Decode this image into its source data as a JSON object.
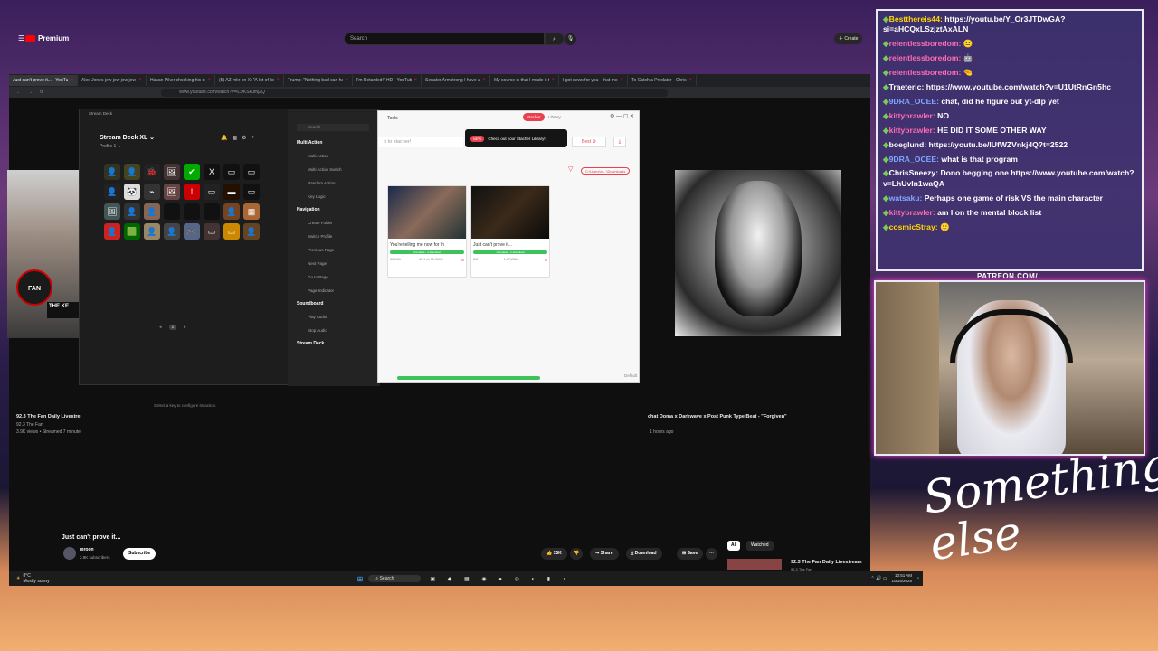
{
  "browser": {
    "tabs": [
      "Just can't prove it... - YouTube",
      "Alex Jones jew jew jew jew",
      "Hasan Piker shocking his dog o",
      "(5) AZ mkr on X: \"A lot of boss",
      "Trump: \"Nothing bad can happ",
      "I'm Retarded!\" HD - YouTube",
      "Senator Armstrong I have a dre",
      "My source is that I made it the",
      "I got news for you - that mean",
      "To Catch a Predator - Chris Ha"
    ],
    "url": "www.youtube.com/watch?v=iC9KSkumj2Q"
  },
  "youtube": {
    "logo": "Premium",
    "search_placeholder": "Search",
    "create_label": "Create",
    "left_video": {
      "badge": "FAN",
      "caption": "THE KE",
      "title": "92.3 The Fan Daily Livestre",
      "channel": "92.3 The Fan",
      "meta": "3.9K views • Streamed 7 minute"
    },
    "right_video": {
      "title": "chat Doma x Darkwave x Post Punk Type Beat - \"Forgiven\"",
      "meta": "1 hours ago"
    },
    "main": {
      "title": "Just can't prove it...",
      "channel": "mroon",
      "subs": "2.8K subscribers",
      "subscribe": "Subscribe",
      "likes": "15K",
      "share": "Share",
      "download": "Download",
      "save": "Save"
    },
    "chips": [
      "All",
      "Watched"
    ],
    "sidebar_next": {
      "title": "92.3 The Fan Daily Livestream",
      "channel": "92.3 The Fan"
    }
  },
  "streamdeck": {
    "window_title": "Stream Deck",
    "device": "Stream Deck XL",
    "profile": "Profile 1",
    "pager": "1",
    "hint": "Select a key to configure its action.",
    "search_placeholder": "Search",
    "categories": [
      {
        "name": "Multi Action",
        "items": [
          "Multi Action",
          "Multi Action Switch",
          "Random Action",
          "Key Logic"
        ]
      },
      {
        "name": "Navigation",
        "items": [
          "Create Folder",
          "Switch Profile",
          "Previous Page",
          "Next Page",
          "Go to Page",
          "Page Indicator"
        ]
      },
      {
        "name": "Soundboard",
        "items": [
          "Play Audio",
          "Stop Audio"
        ]
      },
      {
        "name": "Stream Deck",
        "items": []
      }
    ],
    "keys": [
      "👤",
      "👤",
      "🐞",
      "🖼",
      "✔",
      "X",
      "▭",
      "▭",
      "👤",
      "🐼",
      "⌁",
      "🖼",
      "!",
      "▭",
      "▬",
      "▭",
      "🖼",
      "👤",
      "👤",
      "",
      "",
      "",
      "👤",
      "▦",
      "👤",
      "🟩",
      "👤",
      "👤",
      "🎮",
      "▭",
      "▭",
      "👤"
    ]
  },
  "stacher": {
    "tools": "Tools",
    "tab_stacher": "Stacher",
    "tab_library": "Library",
    "input_placeholder": "o to stacher!",
    "banner_new": "NEW",
    "banner_text": "Check out your Stacher Library!",
    "best_label": "Best ⚙",
    "path": "C:\\Users\\m...\\Downloads",
    "cards": [
      {
        "title": "You're telling me now for th",
        "status": "Complete - 1 download",
        "meta_left": "56 MiB",
        "meta_mid": "45.1 at 35.0MiB"
      },
      {
        "title": "Just can't prove it...",
        "status": "Complete - 1 download",
        "meta_left": "8/8",
        "meta_mid": "1.47MiB/s"
      }
    ],
    "default_label": "Default"
  },
  "taskbar": {
    "weather": "8°C",
    "weather_desc": "Mostly sunny",
    "search": "Search",
    "time": "10:51 AM",
    "date": "10/15/2025"
  },
  "chat": [
    {
      "user": "Bestthereis44:",
      "color": "#ffd700",
      "text": " https://youtu.be/Y_Or3JTDwGA?si=aHCQxLSzjztAxALN"
    },
    {
      "user": "relentlessboredom:",
      "color": "#ff69b4",
      "text": " 😐"
    },
    {
      "user": "relentlessboredom:",
      "color": "#ff69b4",
      "text": " 🤖"
    },
    {
      "user": "relentlessboredom:",
      "color": "#ff69b4",
      "text": " 🤏"
    },
    {
      "user": "Traeteric:",
      "color": "#ffffff",
      "text": " https://www.youtube.com/watch?v=U1UtRnGn5hc"
    },
    {
      "user": "9DRA_OCEE:",
      "color": "#7fa7ff",
      "text": " chat, did he figure out yt-dlp yet"
    },
    {
      "user": "kittybrawler:",
      "color": "#ff69b4",
      "text": " NO"
    },
    {
      "user": "kittybrawler:",
      "color": "#ff69b4",
      "text": " HE DID IT SOME OTHER WAY"
    },
    {
      "user": "boeglund:",
      "color": "#ffffff",
      "text": " https://youtu.be/lUfWZVnkj4Q?t=2522"
    },
    {
      "user": "9DRA_OCEE:",
      "color": "#7fa7ff",
      "text": " what is that program"
    },
    {
      "user": "ChrisSneezy:",
      "color": "#ffffff",
      "text": " Dono begging one https://www.youtube.com/watch?v=LhUvIn1waQA"
    },
    {
      "user": "watsaku:",
      "color": "#7fa7ff",
      "text": " Perhaps one game of risk VS the main character"
    },
    {
      "user": "kittybrawler:",
      "color": "#ff69b4",
      "text": " am I on the mental block list"
    },
    {
      "user": "cosmicStray:",
      "color": "#ffd700",
      "text": " 🙂"
    }
  ],
  "overlay": {
    "patreon": "PATREON.COM/",
    "brand": "Something else"
  }
}
